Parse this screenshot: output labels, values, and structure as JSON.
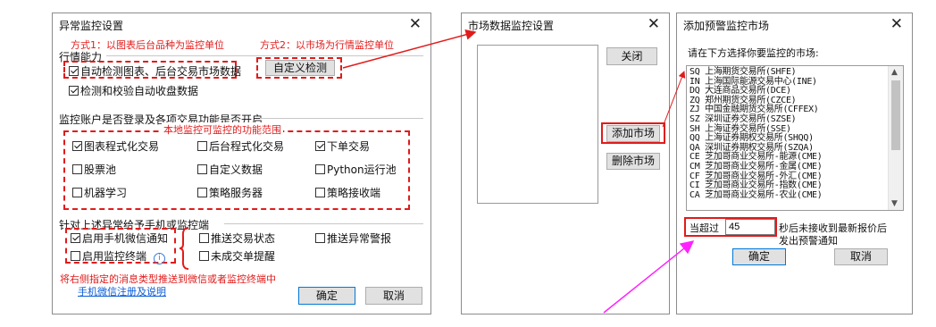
{
  "dialog1": {
    "title": "异常监控设置",
    "close": "✕",
    "annotation1": "方式1：以图表后台品种为监控单位",
    "annotation2": "方式2：以市场为行情监控单位",
    "section_behavior": "行情能力",
    "chk_auto_detect": "自动检测图表、后台交易市场数据",
    "btn_custom_detect": "自定义检测",
    "chk_verify_close": "检测和校验自动收盘数据",
    "section_account": "监控账户是否登录及各项交易功能是否开启",
    "annotation_scope": "本地监控可监控的功能范围",
    "options": [
      {
        "label": "图表程式化交易",
        "checked": true
      },
      {
        "label": "后台程式化交易",
        "checked": false
      },
      {
        "label": "下单交易",
        "checked": true
      },
      {
        "label": "股票池",
        "checked": false
      },
      {
        "label": "自定义数据",
        "checked": false
      },
      {
        "label": "Python运行池",
        "checked": false
      },
      {
        "label": "机器学习",
        "checked": false
      },
      {
        "label": "策略服务器",
        "checked": false
      },
      {
        "label": "策略接收端",
        "checked": false
      }
    ],
    "section_notify": "针对上述异常给予手机或监控端",
    "chk_wechat": "启用手机微信通知",
    "chk_terminal": "启用监控终端",
    "chk_push_trade": "推送交易状态",
    "chk_push_alarm": "推送异常警报",
    "chk_unfilled": "未成交单提醒",
    "annotation_push": "将右侧指定的消息类型推送到微信或者监控终端中",
    "link_register": "手机微信注册及说明",
    "btn_ok": "确定",
    "btn_cancel": "取消"
  },
  "dialog2": {
    "title": "市场数据监控设置",
    "close": "✕",
    "btn_close": "关闭",
    "btn_add": "添加市场",
    "btn_delete": "删除市场"
  },
  "dialog3": {
    "title": "添加预警监控市场",
    "close": "✕",
    "prompt": "请在下方选择你要监控的市场:",
    "markets": [
      "SQ 上海期货交易所(SHFE)",
      "IN 上海国际能源交易中心(INE)",
      "DQ 大连商品交易所(DCE)",
      "ZQ 郑州期货交易所(CZCE)",
      "ZJ 中国金融期货交易所(CFFEX)",
      "SZ 深圳证券交易所(SZSE)",
      "SH 上海证券交易所(SSE)",
      "QQ 上海证券期权交易所(SHQQ)",
      "QA 深圳证券期权交易所(SZQA)",
      "CE 芝加哥商业交易所-能源(CME)",
      "CM 芝加哥商业交易所-金属(CME)",
      "CF 芝加哥商业交易所-外汇(CME)",
      "CI 芝加哥商业交易所-指数(CME)",
      "CA 芝加哥商业交易所-农业(CME)"
    ],
    "timeout_prefix": "当超过",
    "timeout_value": "45",
    "timeout_suffix1": "秒后未接收到最新报价后",
    "timeout_suffix2": "发出预警通知",
    "btn_ok": "确定",
    "btn_cancel": "取消"
  },
  "colors": {
    "annotation": "#e11b1b",
    "arrow": "#ff22ff",
    "link": "#0a5bd6"
  }
}
